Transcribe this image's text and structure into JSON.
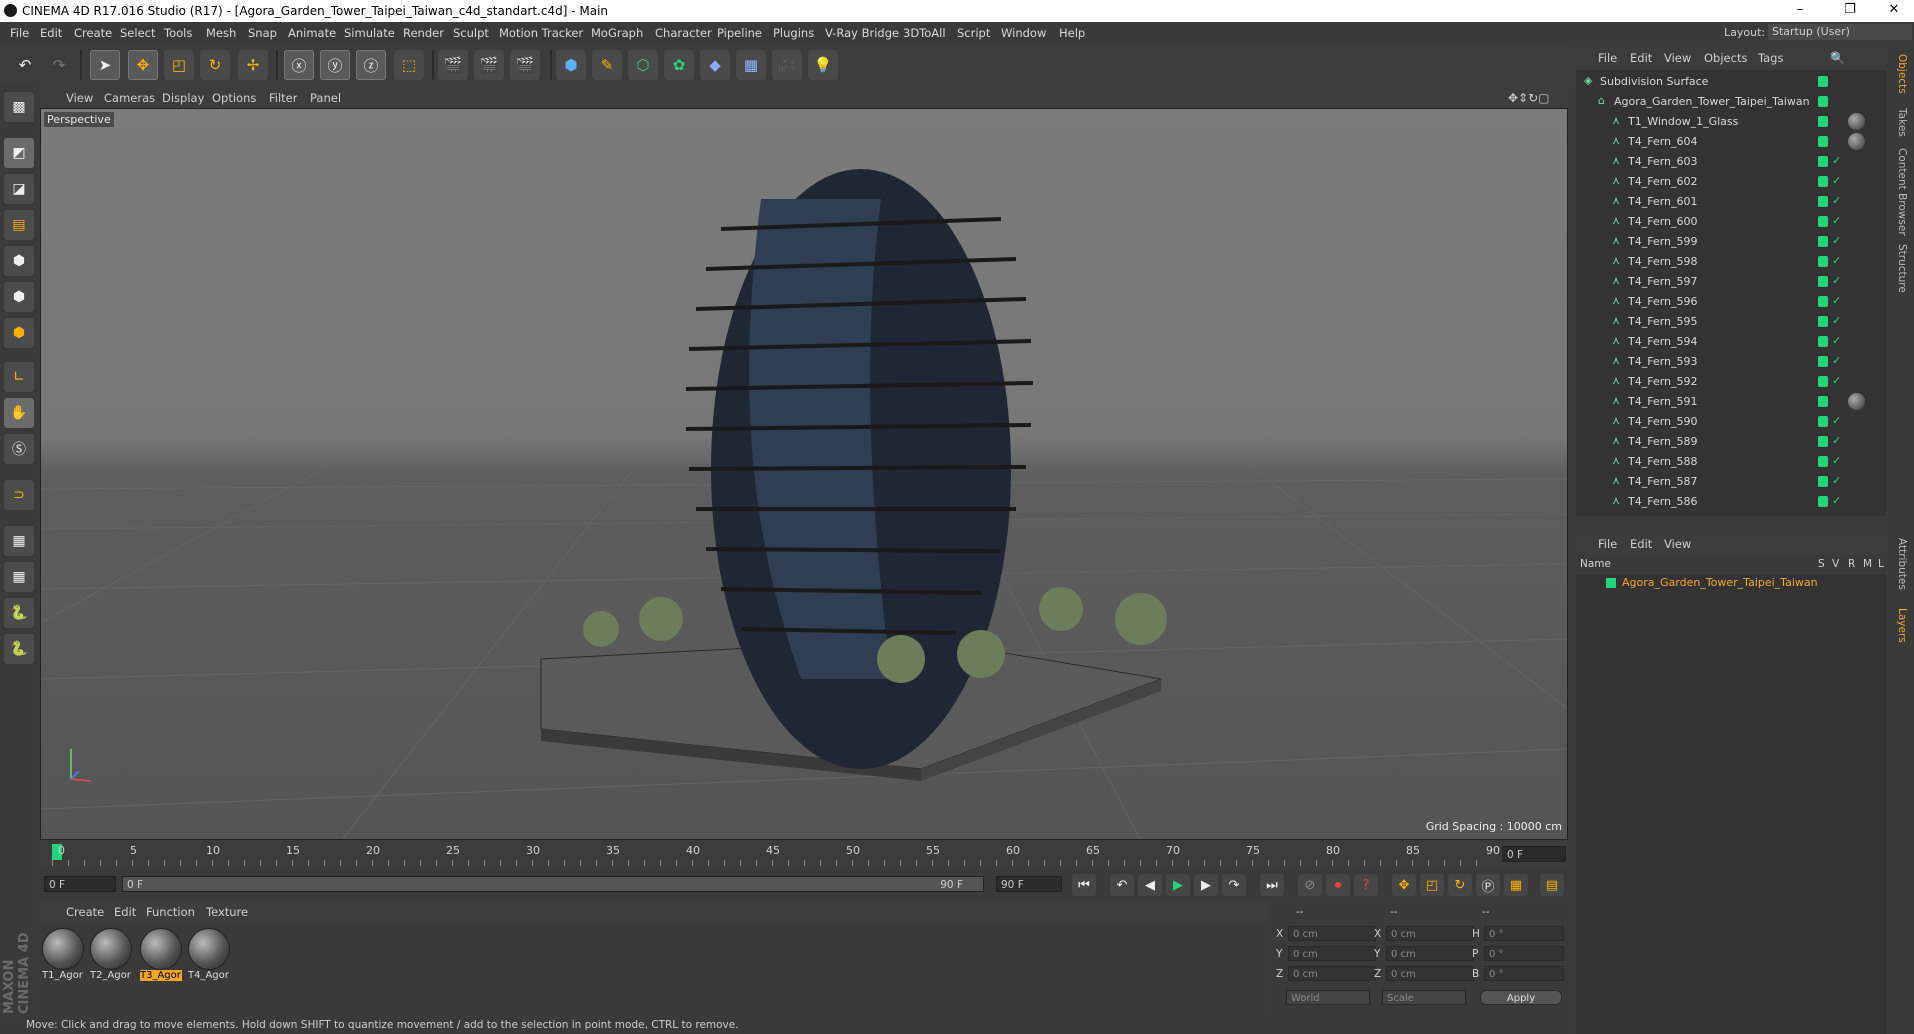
{
  "window": {
    "title": "CINEMA 4D R17.016 Studio (R17) - [Agora_Garden_Tower_Taipei_Taiwan_c4d_standart.c4d] - Main",
    "min": "–",
    "max": "❐",
    "close": "✕"
  },
  "menu": [
    "File",
    "Edit",
    "Create",
    "Select",
    "Tools",
    "Mesh",
    "Snap",
    "Animate",
    "Simulate",
    "Render",
    "Sculpt",
    "Motion Tracker",
    "MoGraph",
    "Character",
    "Pipeline",
    "Plugins",
    "V-Ray Bridge",
    "3DToAll",
    "Script",
    "Window",
    "Help"
  ],
  "layout": {
    "label": "Layout:",
    "value": "Startup (User)"
  },
  "viewport": {
    "menu": [
      "View",
      "Cameras",
      "Display",
      "Options",
      "Filter",
      "Panel"
    ],
    "label": "Perspective",
    "grid_spacing": "Grid Spacing : 10000 cm"
  },
  "timeline": {
    "ticks": [
      "0",
      "5",
      "10",
      "15",
      "20",
      "25",
      "30",
      "35",
      "40",
      "45",
      "50",
      "55",
      "60",
      "65",
      "70",
      "75",
      "80",
      "85",
      "90"
    ],
    "current_frame": "0 F",
    "start": "0 F",
    "range_start": "0 F",
    "range_end": "90 F",
    "end": "90 F"
  },
  "materials": {
    "menu": [
      "Create",
      "Edit",
      "Function",
      "Texture"
    ],
    "items": [
      {
        "label": "T1_Agor"
      },
      {
        "label": "T2_Agor"
      },
      {
        "label": "T3_Agor"
      },
      {
        "label": "T4_Agor"
      }
    ]
  },
  "coords": {
    "headers": [
      "--",
      "--",
      "--"
    ],
    "rows": [
      {
        "a": "X",
        "av": "0 cm",
        "b": "X",
        "bv": "0 cm",
        "c": "H",
        "cv": "0 °"
      },
      {
        "a": "Y",
        "av": "0 cm",
        "b": "Y",
        "bv": "0 cm",
        "c": "P",
        "cv": "0 °"
      },
      {
        "a": "Z",
        "av": "0 cm",
        "b": "Z",
        "bv": "0 cm",
        "c": "B",
        "cv": "0 °"
      }
    ],
    "mode1": "World",
    "mode2": "Scale",
    "apply": "Apply"
  },
  "status": "Move: Click and drag to move elements. Hold down SHIFT to quantize movement / add to the selection in point mode, CTRL to remove.",
  "object_manager": {
    "menu": [
      "File",
      "Edit",
      "View",
      "Objects",
      "Tags"
    ],
    "rows": [
      {
        "name": "Subdivision Surface",
        "level": 0
      },
      {
        "name": "Agora_Garden_Tower_Taipei_Taiwan",
        "level": 1
      },
      {
        "name": "T1_Window_1_Glass",
        "level": 2
      },
      {
        "name": "T4_Fern_604",
        "level": 2
      },
      {
        "name": "T4_Fern_603",
        "level": 2
      },
      {
        "name": "T4_Fern_602",
        "level": 2
      },
      {
        "name": "T4_Fern_601",
        "level": 2
      },
      {
        "name": "T4_Fern_600",
        "level": 2
      },
      {
        "name": "T4_Fern_599",
        "level": 2
      },
      {
        "name": "T4_Fern_598",
        "level": 2
      },
      {
        "name": "T4_Fern_597",
        "level": 2
      },
      {
        "name": "T4_Fern_596",
        "level": 2
      },
      {
        "name": "T4_Fern_595",
        "level": 2
      },
      {
        "name": "T4_Fern_594",
        "level": 2
      },
      {
        "name": "T4_Fern_593",
        "level": 2
      },
      {
        "name": "T4_Fern_592",
        "level": 2
      },
      {
        "name": "T4_Fern_591",
        "level": 2
      },
      {
        "name": "T4_Fern_590",
        "level": 2
      },
      {
        "name": "T4_Fern_589",
        "level": 2
      },
      {
        "name": "T4_Fern_588",
        "level": 2
      },
      {
        "name": "T4_Fern_587",
        "level": 2
      },
      {
        "name": "T4_Fern_586",
        "level": 2
      }
    ]
  },
  "layer_manager": {
    "menu": [
      "File",
      "Edit",
      "View"
    ],
    "columns": [
      "Name",
      "S",
      "V",
      "R",
      "M",
      "L"
    ],
    "layer": "Agora_Garden_Tower_Taipei_Taiwan"
  },
  "right_tabs": [
    "Objects",
    "Takes",
    "Content Browser",
    "Structure",
    "Attributes",
    "Layers"
  ],
  "brand": "MAXON CINEMA 4D",
  "colors": {
    "accent_green": "#1fd67a",
    "accent_orange": "#f5a623",
    "bg": "#3b3b3b"
  }
}
